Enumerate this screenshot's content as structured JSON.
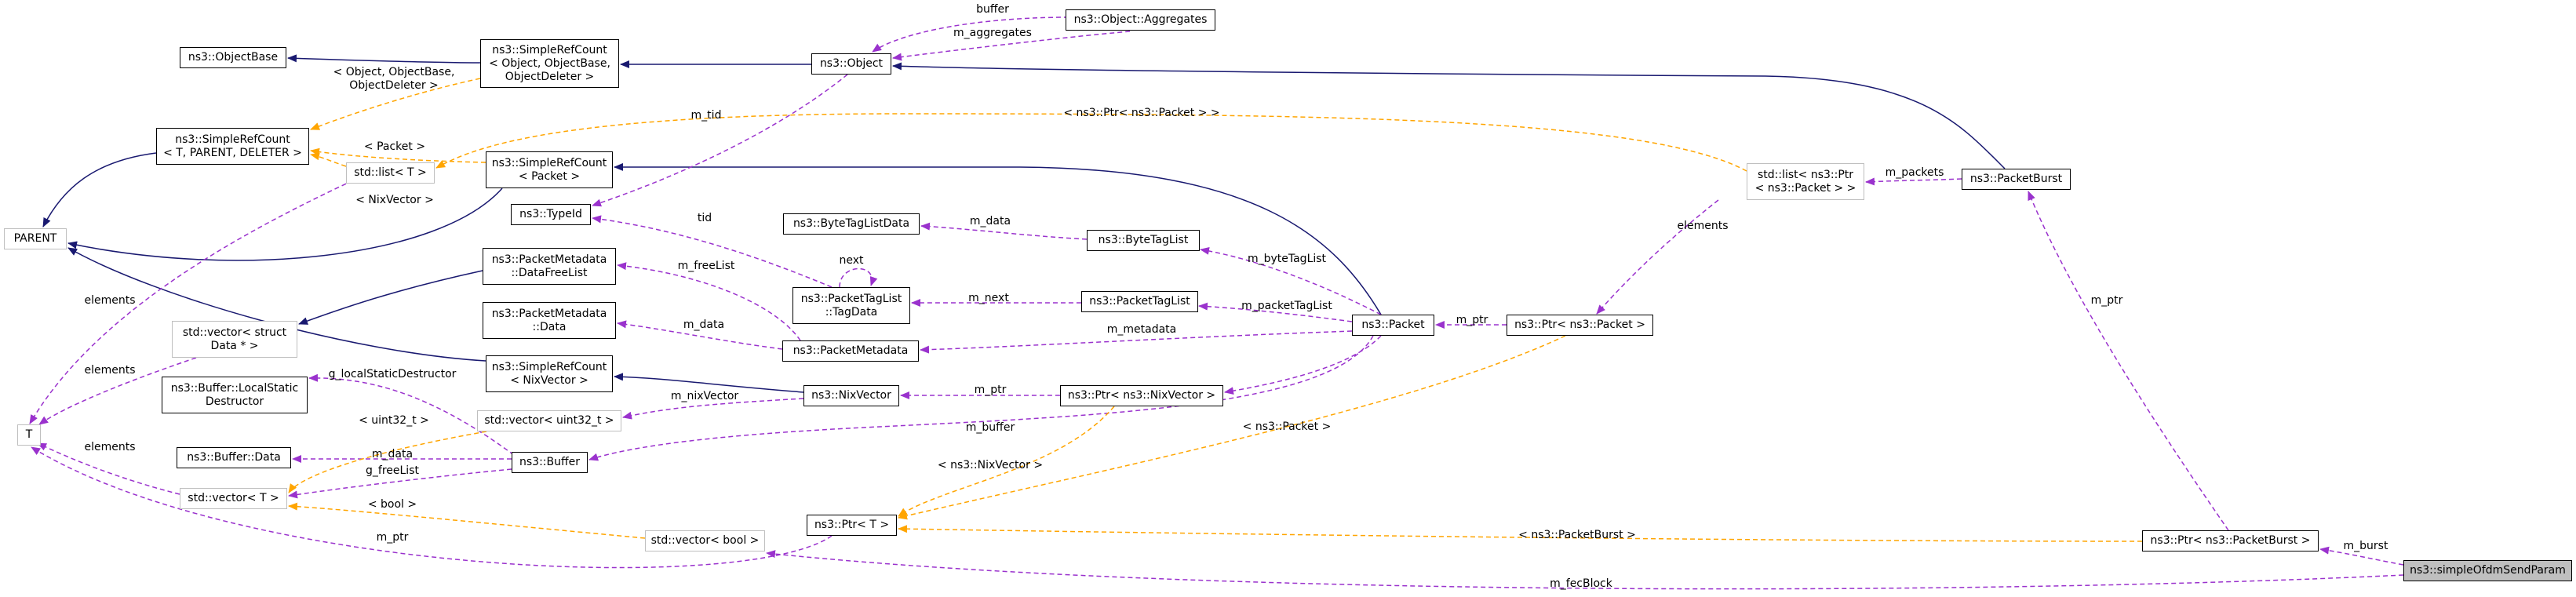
{
  "nodes": [
    {
      "id": "objectbase",
      "label": "ns3::ObjectBase"
    },
    {
      "id": "srefcount_object",
      "label": "ns3::SimpleRefCount\n< Object, ObjectBase,\nObjectDeleter >"
    },
    {
      "id": "object",
      "label": "ns3::Object"
    },
    {
      "id": "aggregates",
      "label": "ns3::Object::Aggregates"
    },
    {
      "id": "srefcount_tpd",
      "label": "ns3::SimpleRefCount\n< T, PARENT, DELETER >"
    },
    {
      "id": "list_t",
      "label": "std::list< T >"
    },
    {
      "id": "srefcount_packet",
      "label": "ns3::SimpleRefCount\n< Packet >"
    },
    {
      "id": "parent",
      "label": "PARENT"
    },
    {
      "id": "typeid",
      "label": "ns3::TypeId"
    },
    {
      "id": "bytetaglistdata",
      "label": "ns3::ByteTagListData"
    },
    {
      "id": "bytetaglist",
      "label": "ns3::ByteTagList"
    },
    {
      "id": "pm_datafreelist",
      "label": "ns3::PacketMetadata\n::DataFreeList"
    },
    {
      "id": "ptl_tagdata",
      "label": "ns3::PacketTagList\n::TagData"
    },
    {
      "id": "packettaglist",
      "label": "ns3::PacketTagList"
    },
    {
      "id": "pm_data",
      "label": "ns3::PacketMetadata\n::Data"
    },
    {
      "id": "packetmetadata",
      "label": "ns3::PacketMetadata"
    },
    {
      "id": "packet",
      "label": "ns3::Packet"
    },
    {
      "id": "ptr_packet",
      "label": "ns3::Ptr< ns3::Packet >"
    },
    {
      "id": "list_ptr_packet",
      "label": "std::list< ns3::Ptr\n< ns3::Packet > >"
    },
    {
      "id": "packetburst",
      "label": "ns3::PacketBurst"
    },
    {
      "id": "vector_struct_data",
      "label": "std::vector< struct\nData * >"
    },
    {
      "id": "srefcount_nixvector",
      "label": "ns3::SimpleRefCount\n< NixVector >"
    },
    {
      "id": "buffer_localstatic",
      "label": "ns3::Buffer::LocalStatic\nDestructor"
    },
    {
      "id": "nixvector",
      "label": "ns3::NixVector"
    },
    {
      "id": "ptr_nixvector",
      "label": "ns3::Ptr< ns3::NixVector >"
    },
    {
      "id": "t",
      "label": "T"
    },
    {
      "id": "vector_uint32",
      "label": "std::vector< uint32_t >"
    },
    {
      "id": "buffer_data",
      "label": "ns3::Buffer::Data"
    },
    {
      "id": "buffer",
      "label": "ns3::Buffer"
    },
    {
      "id": "vector_t",
      "label": "std::vector< T >"
    },
    {
      "id": "ptr_t",
      "label": "ns3::Ptr< T >"
    },
    {
      "id": "vector_bool",
      "label": "std::vector< bool >"
    },
    {
      "id": "ptr_packetburst",
      "label": "ns3::Ptr< ns3::PacketBurst >"
    },
    {
      "id": "simpleofdm",
      "label": "ns3::simpleOfdmSendParam"
    }
  ],
  "edge_labels": [
    {
      "id": "e_buffer",
      "text": "buffer"
    },
    {
      "id": "e_aggregates",
      "text": "m_aggregates"
    },
    {
      "id": "e_obj_args",
      "text": "< Object, ObjectBase,\nObjectDeleter >"
    },
    {
      "id": "e_mtid",
      "text": "m_tid"
    },
    {
      "id": "e_ptr_pkt_list",
      "text": "< ns3::Ptr< ns3::Packet > >"
    },
    {
      "id": "e_packet_arg",
      "text": "< Packet >"
    },
    {
      "id": "e_nixvector_arg",
      "text": "< NixVector >"
    },
    {
      "id": "e_tid",
      "text": "tid"
    },
    {
      "id": "e_m_data_btl",
      "text": "m_data"
    },
    {
      "id": "e_next",
      "text": "next"
    },
    {
      "id": "e_m_packets",
      "text": "m_packets"
    },
    {
      "id": "e_elements_list",
      "text": "elements"
    },
    {
      "id": "e_bytetaglist",
      "text": "m_byteTagList"
    },
    {
      "id": "e_freelist",
      "text": "m_freeList"
    },
    {
      "id": "e_m_next",
      "text": "m_next"
    },
    {
      "id": "e_packettaglist",
      "text": "m_packetTagList"
    },
    {
      "id": "e_m_data_pm",
      "text": "m_data"
    },
    {
      "id": "e_metadata",
      "text": "m_metadata"
    },
    {
      "id": "e_m_ptr_pkt",
      "text": "m_ptr"
    },
    {
      "id": "e_elements_t1",
      "text": "elements"
    },
    {
      "id": "e_elements_t2",
      "text": "elements"
    },
    {
      "id": "e_localstatic",
      "text": "g_localStaticDestructor"
    },
    {
      "id": "e_nixvector",
      "text": "m_nixVector"
    },
    {
      "id": "e_m_ptr_nix",
      "text": "m_ptr"
    },
    {
      "id": "e_m_ptr_burst",
      "text": "m_ptr"
    },
    {
      "id": "e_uint32_arg",
      "text": "< uint32_t >"
    },
    {
      "id": "e_elements_t3",
      "text": "elements"
    },
    {
      "id": "e_m_data_buf",
      "text": "m_data"
    },
    {
      "id": "e_m_buffer",
      "text": "m_buffer"
    },
    {
      "id": "e_freelist_g",
      "text": "g_freeList"
    },
    {
      "id": "e_pkt_arg",
      "text": "< ns3::Packet >"
    },
    {
      "id": "e_nix_arg",
      "text": "< ns3::NixVector >"
    },
    {
      "id": "e_bool_arg",
      "text": "< bool >"
    },
    {
      "id": "e_m_ptr_t",
      "text": "m_ptr"
    },
    {
      "id": "e_burst_arg",
      "text": "< ns3::PacketBurst >"
    },
    {
      "id": "e_m_burst",
      "text": "m_burst"
    },
    {
      "id": "e_fecblock",
      "text": "m_fecBlock"
    }
  ],
  "colors": {
    "inheritance": "#191970",
    "usage": "#9a32cd",
    "template": "#ffa500",
    "gray_border": "#bfbfbf",
    "focus_fill": "#bfbfbf"
  }
}
